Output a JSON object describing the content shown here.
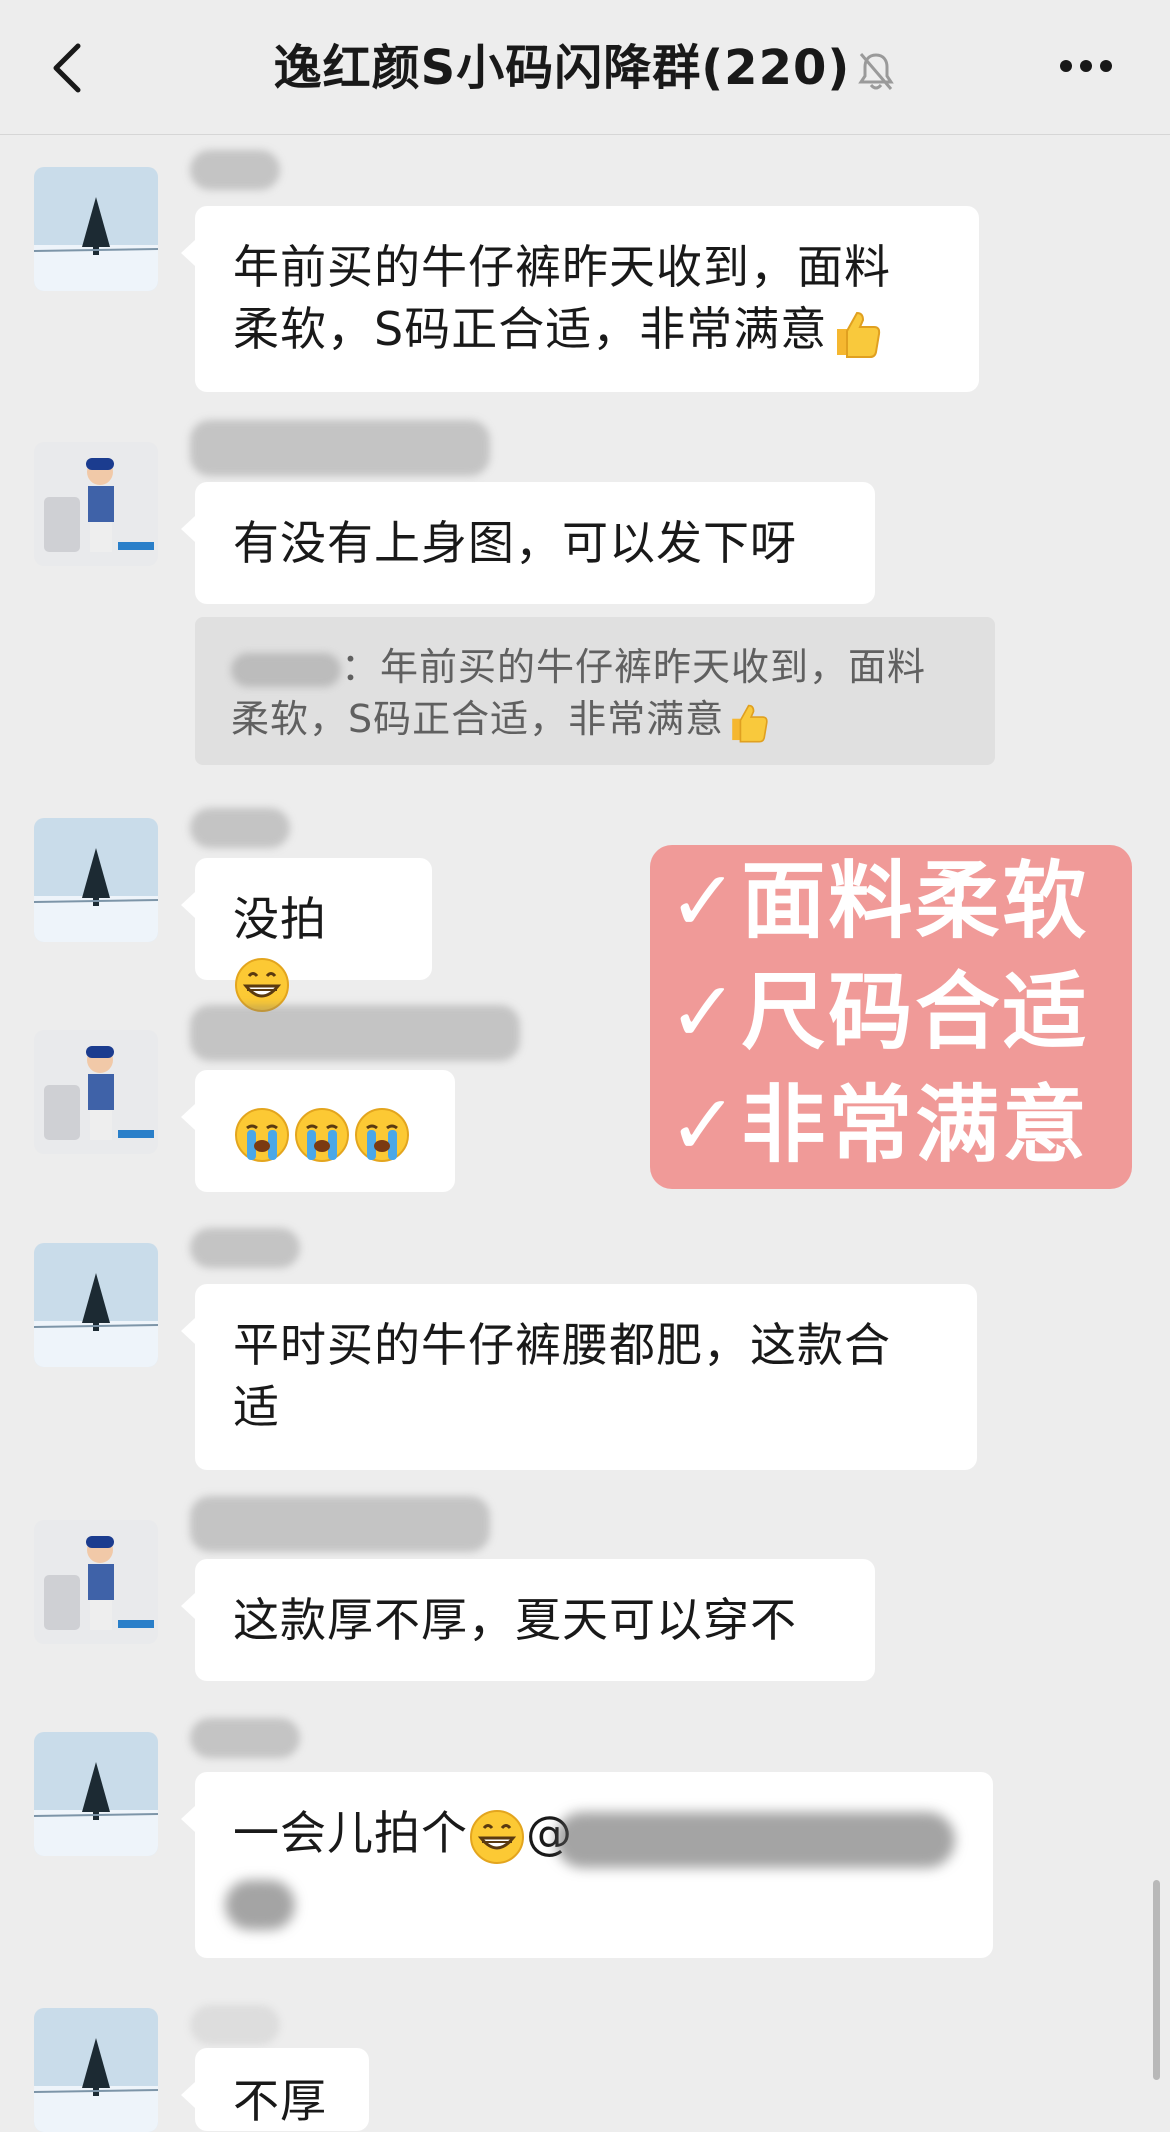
{
  "header": {
    "title": "逸红颜S小码闪降群(220)",
    "back_icon": "chevron-left-icon",
    "mute_icon": "bell-muted-icon",
    "more_icon": "ellipsis-icon"
  },
  "messages": [
    {
      "text": "年前买的牛仔裤昨天收到，面料柔软，S码正合适，非常满意👍",
      "line1": "年前买的牛仔裤昨天收到，面料",
      "line2": "柔软，S码正合适，非常满意"
    },
    {
      "text": "有没有上身图，可以发下呀"
    },
    {
      "text": "没拍😁"
    },
    {
      "text": "😭😭😭"
    },
    {
      "text": "平时买的牛仔裤腰都肥，这款合适",
      "line1": "平时买的牛仔裤腰都肥，这款合",
      "line2": "适"
    },
    {
      "text": "这款厚不厚，夏天可以穿不"
    },
    {
      "text": "一会儿拍个😁@",
      "before_emoji": "一会儿拍个",
      "after_emoji": "@"
    },
    {
      "text": "不厚"
    }
  ],
  "quote": {
    "separator": "：",
    "line1": "年前买的牛仔裤昨天收到，面料",
    "line2": "柔软，S码正合适，非常满意"
  },
  "highlights": [
    "✓面料柔软",
    "✓尺码合适",
    "✓非常满意"
  ],
  "colors": {
    "background": "#ededed",
    "bubble": "#ffffff",
    "quote": "#e0e0e0",
    "highlight": "#f09a98"
  }
}
